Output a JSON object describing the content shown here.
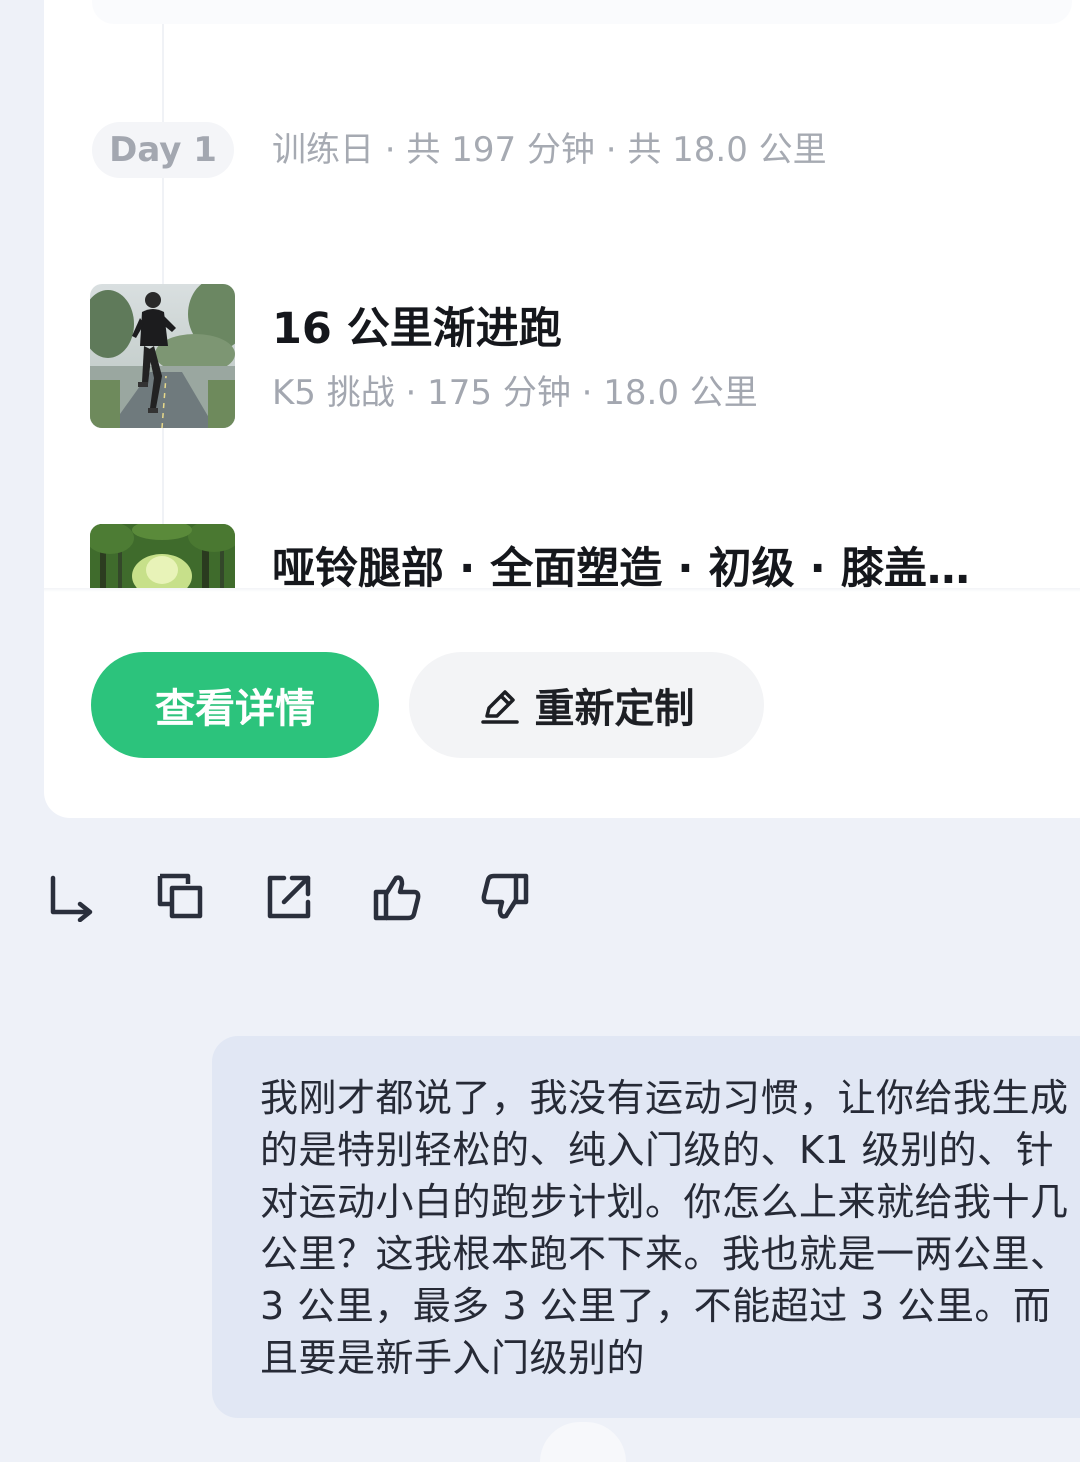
{
  "plan": {
    "day_label": "Day 1",
    "day_summary": "训练日 · 共 197 分钟 · 共 18.0 公里",
    "items": [
      {
        "title": "16 公里渐进跑",
        "subtitle": "K5 挑战 · 175 分钟 · 18.0 公里",
        "thumb_icon": "runner-photo"
      },
      {
        "title": "哑铃腿部 · 全面塑造 · 初级 · 膝盖…",
        "thumb_icon": "forest-photo"
      }
    ]
  },
  "buttons": {
    "view_details": "查看详情",
    "customize": "重新定制",
    "customize_icon": "pencil-icon"
  },
  "actions": [
    "reply-icon",
    "copy-icon",
    "share-icon",
    "thumbs-up-icon",
    "thumbs-down-icon"
  ],
  "message": {
    "text": "我刚才都说了，我没有运动习惯，让你给我生成的是特别轻松的、纯入门级的、K1 级别的、针对运动小白的跑步计划。你怎么上来就给我十几公里？这我根本跑不下来。我也就是一两公里、3 公里，最多 3 公里了，不能超过 3 公里。而且要是新手入门级别的"
  },
  "colors": {
    "accent": "#2cc37c",
    "background": "#eef1f8",
    "bubble": "#e1e7f4"
  }
}
